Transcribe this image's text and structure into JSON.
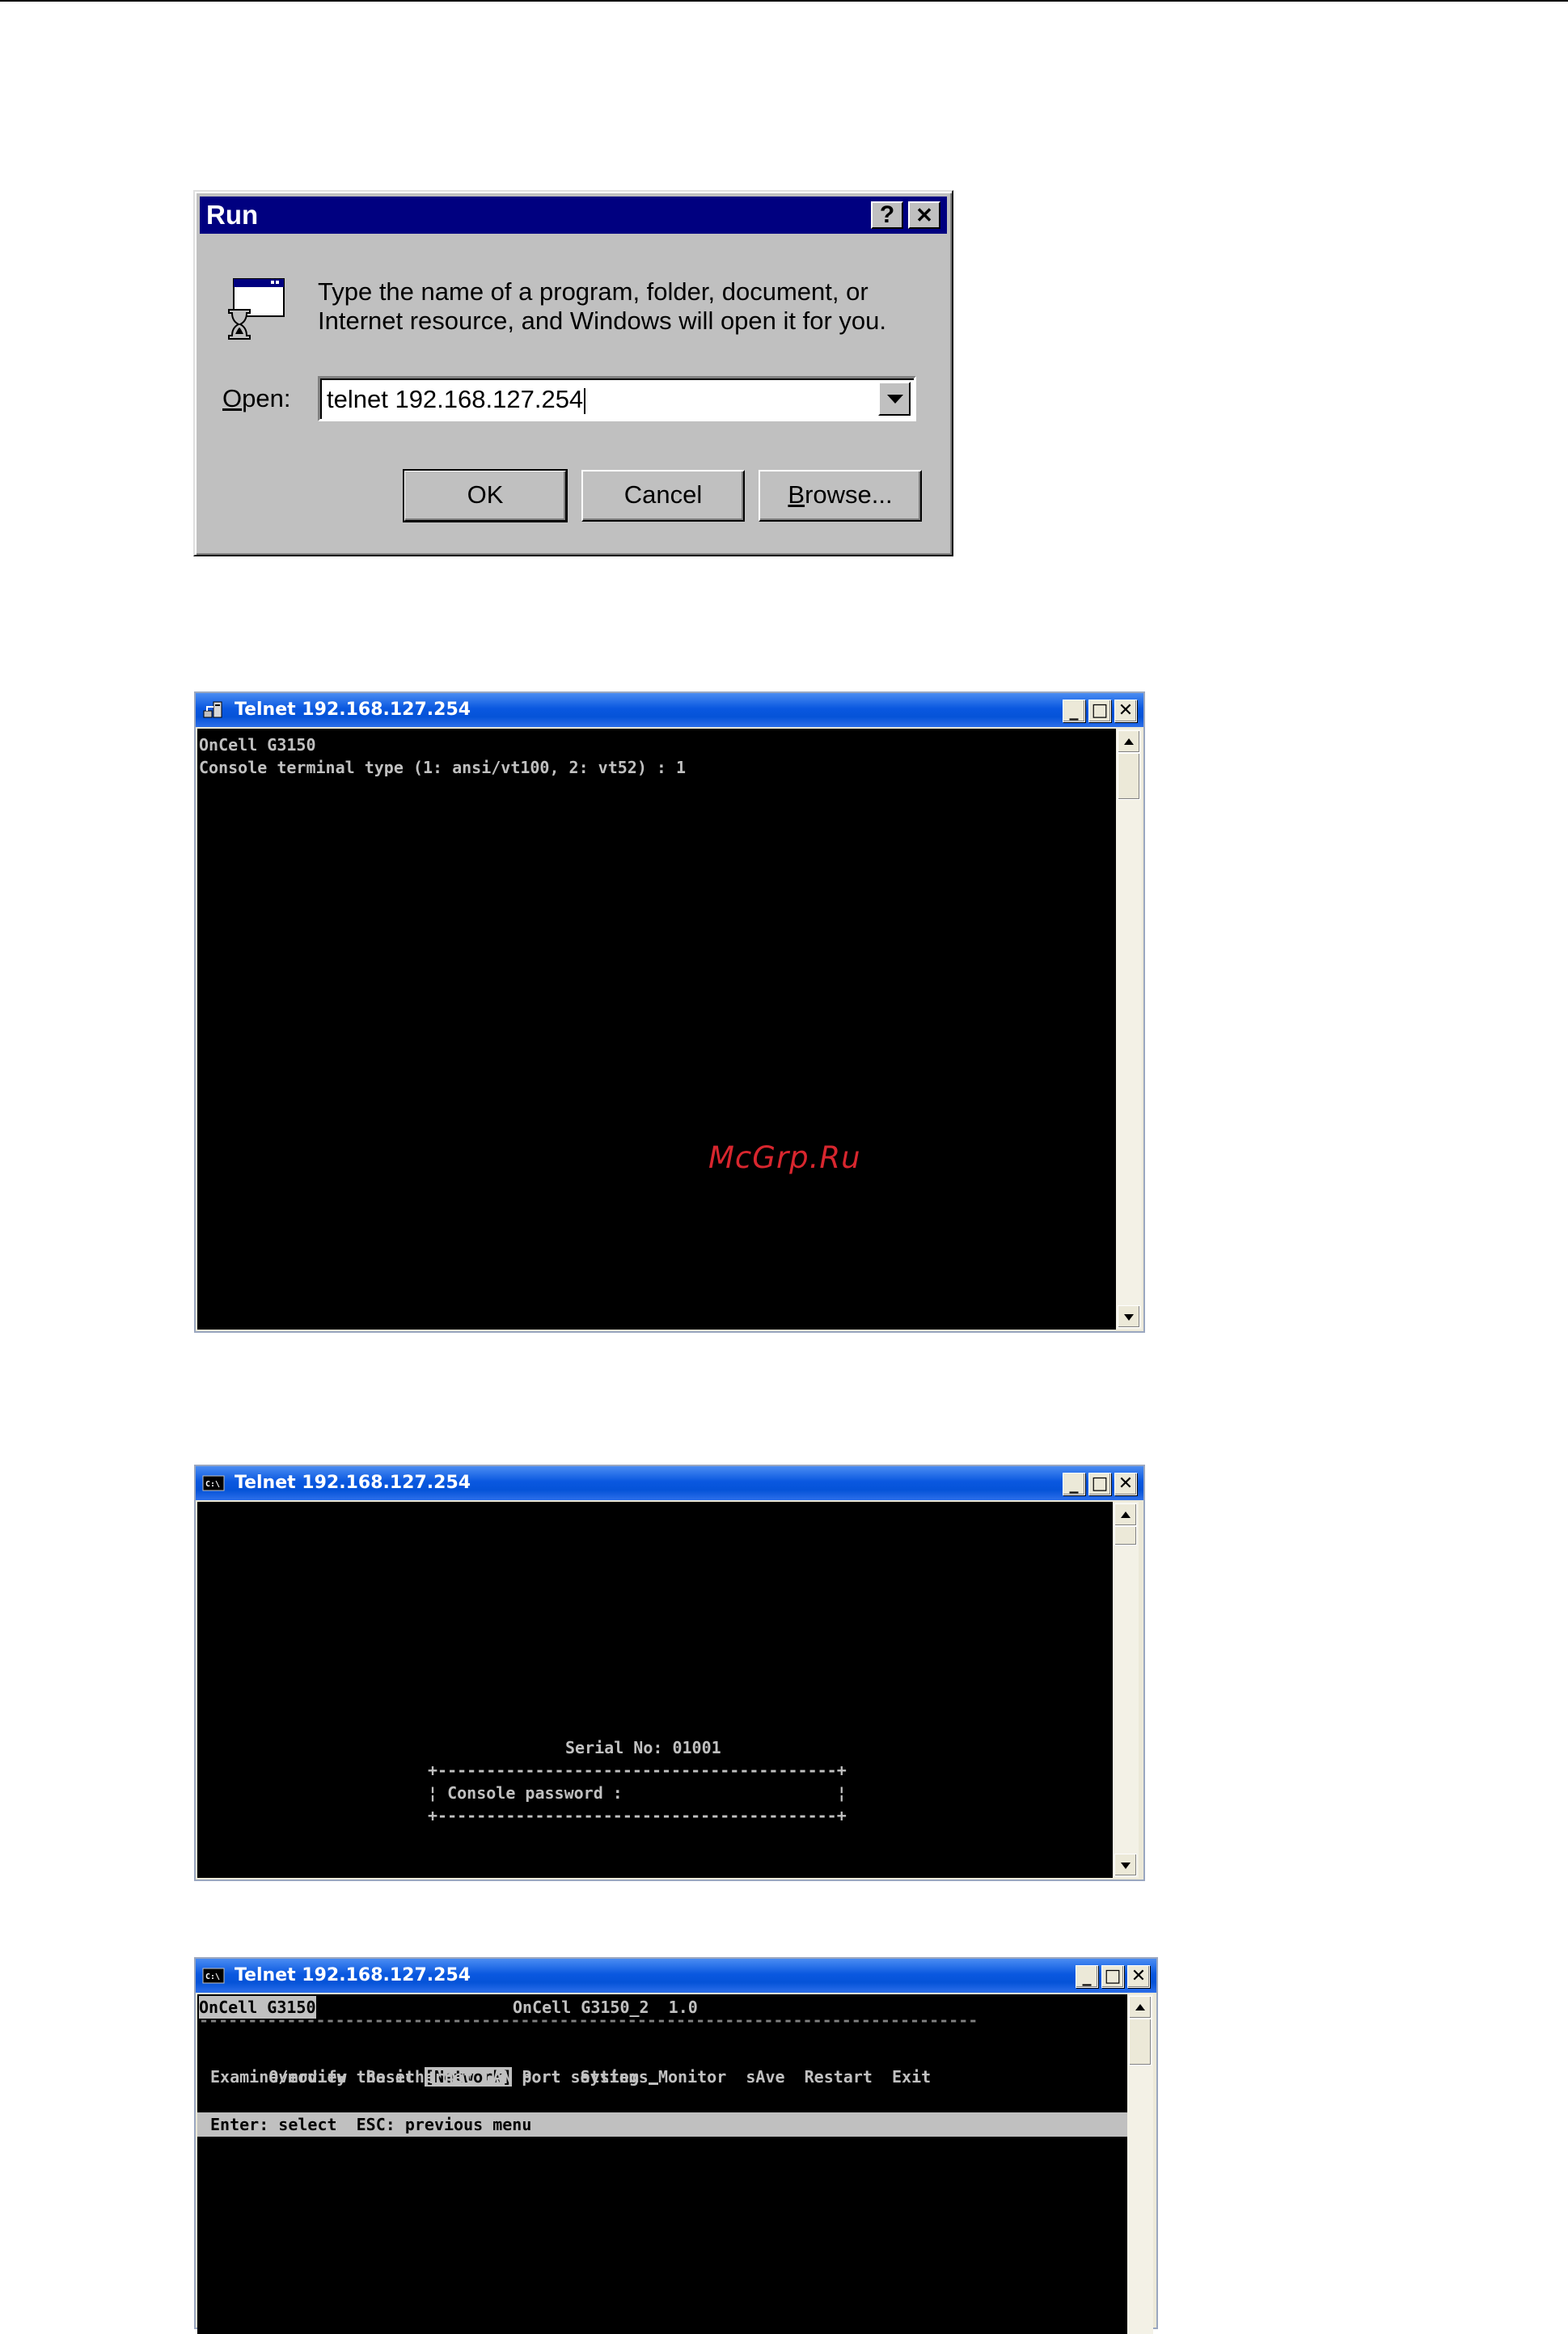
{
  "run_dialog": {
    "title": "Run",
    "help_glyph": "?",
    "close_glyph": "✕",
    "icon": "run-program-icon",
    "message": "Type the name of a program, folder, document, or Internet resource, and Windows will open it for you.",
    "open_label_accel": "O",
    "open_label_rest": "pen:",
    "open_value": "telnet 192.168.127.254",
    "ok_label": "OK",
    "cancel_label": "Cancel",
    "browse_label_accel": "B",
    "browse_label_rest": "rowse..."
  },
  "window1": {
    "title": "Telnet 192.168.127.254",
    "icon": "telnet-icon",
    "lines": [
      "OnCell G3150",
      "Console terminal type (1: ansi/vt100, 2: vt52) : 1"
    ]
  },
  "watermark": "McGrp.Ru",
  "window2": {
    "title": "Telnet 192.168.127.254",
    "icon": "console-icon",
    "serial": "Serial No: 01001",
    "box_top": "+-----------------------------------------+",
    "box_line": "¦ Console password :                      ¦",
    "box_bottom": "+-----------------------------------------+"
  },
  "window3": {
    "title": "Telnet 192.168.127.254",
    "icon": "console-icon",
    "header_left": "OnCell G3150",
    "header_center": "OnCell G3150_2  1.0",
    "separator": "--------------------------------------------------------------------------------",
    "menu": [
      "Overview",
      "Basic",
      "[Network]",
      "Port",
      "System",
      "Monitor",
      "sAve",
      "Restart",
      "Exit"
    ],
    "selected_index": 2,
    "description": "Examine/modify the ethernet LAN port settings",
    "status": "Enter: select  ESC: previous menu"
  },
  "window_controls": {
    "minimize": "_",
    "maximize": "□",
    "close": "✕"
  }
}
